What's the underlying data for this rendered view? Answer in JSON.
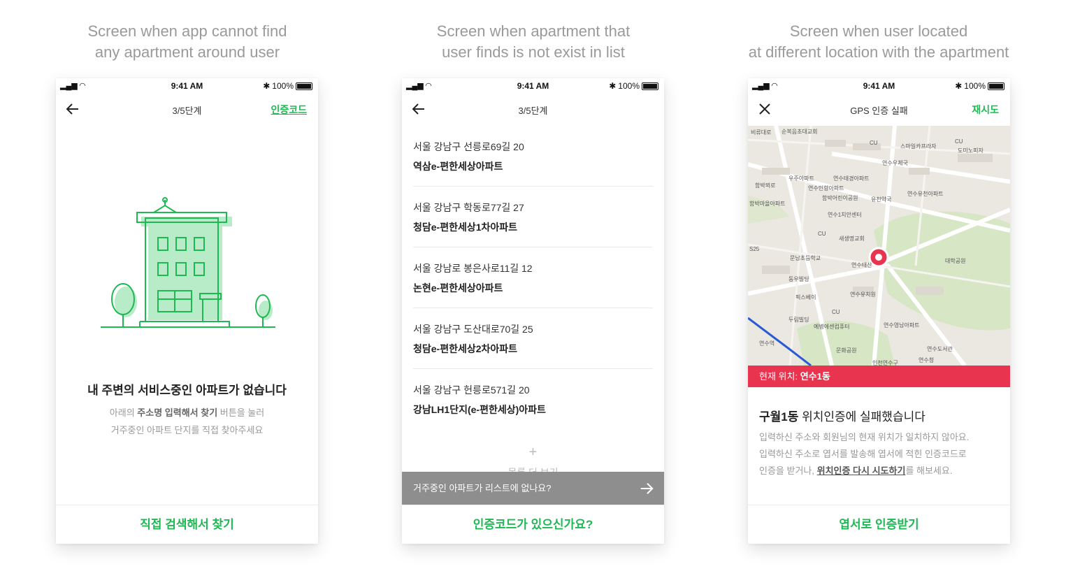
{
  "captions": [
    {
      "line1": "Screen when app cannot find",
      "line2": "any apartment around user"
    },
    {
      "line1": "Screen when apartment that",
      "line2": "user finds is not exist in list"
    },
    {
      "line1": "Screen when user located",
      "line2": "at different location with the apartment"
    }
  ],
  "status_bar": {
    "time": "9:41 AM",
    "battery": "100%"
  },
  "screen1": {
    "nav_title": "3/5단계",
    "nav_link": "인증코드",
    "empty_title": "내 주변의 서비스중인 아파트가 없습니다",
    "desc_pre": "아래의 ",
    "desc_bold": "주소명 입력해서 찾기",
    "desc_post": " 버튼을 눌러",
    "desc_line2": "거주중인 아파트 단지를 직접 찾아주세요",
    "bottom_button": "직접 검색해서 찾기"
  },
  "screen2": {
    "nav_title": "3/5단계",
    "items": [
      {
        "address": "서울 강남구 선릉로69길 20",
        "name": "역삼e-편한세상아파트"
      },
      {
        "address": "서울 강남구 학동로77길 27",
        "name": "청담e-편한세상1차아파트"
      },
      {
        "address": "서울 강남로 봉은사로11길 12",
        "name": "논현e-편한세상아파트"
      },
      {
        "address": "서울 강남구 도산대로70길 25",
        "name": "청담e-편한세상2차아파트"
      },
      {
        "address": "서울 강남구 헌릉로571길 20",
        "name": "강남LH1단지(e-편한세상)아파트"
      }
    ],
    "more_symbol": "+",
    "more_label": "목록 더 보기",
    "banner_text": "거주중인 아파트가 리스트에 없나요?",
    "bottom_button": "인증코드가 있으신가요?"
  },
  "screen3": {
    "nav_title": "GPS 인증 실패",
    "nav_link": "재시도",
    "map_labels": [
      "비류대로",
      "순복음초대교회",
      "CU",
      "스마일카프라자",
      "CU",
      "도미노피자",
      "연수우체국",
      "함박마을아파트",
      "우주아파트",
      "연수태경아파트",
      "연수인향아파트",
      "함박어린이공원",
      "유천약국",
      "연수유천아파트",
      "함박뫼로",
      "연수1치안센터",
      "CU",
      "새생명교회",
      "대학공원",
      "문남초등학교",
      "연수태산",
      "동우빌딩",
      "픽스베이",
      "연수유치원",
      "CU",
      "두림빌딩",
      "예병에센컴퓨터",
      "연수영남아파트",
      "연수역",
      "문화공원",
      "연수도서관",
      "인천연수구",
      "연수청",
      "S25"
    ],
    "current_location_label": "현재 위치: ",
    "current_location_value": "연수1동",
    "fail_bold": "구월1동",
    "fail_rest": " 위치인증에 실패했습니다",
    "desc_line1": "입력하신 주소와 회원님의 현재 위치가 일치하지 않아요.",
    "desc_line2": "입력하신 주소로 엽서를 발송해 엽서에 적힌 인증코드로",
    "desc_line3_pre": "인증을 받거나, ",
    "desc_line3_link": "위치인증 다시 시도하기",
    "desc_line3_post": "를 해보세요.",
    "bottom_button": "엽서로 인증받기"
  },
  "colors": {
    "accent_green": "#1fb954",
    "alert_red": "#e8344e",
    "banner_grey": "#8e8e8e"
  }
}
